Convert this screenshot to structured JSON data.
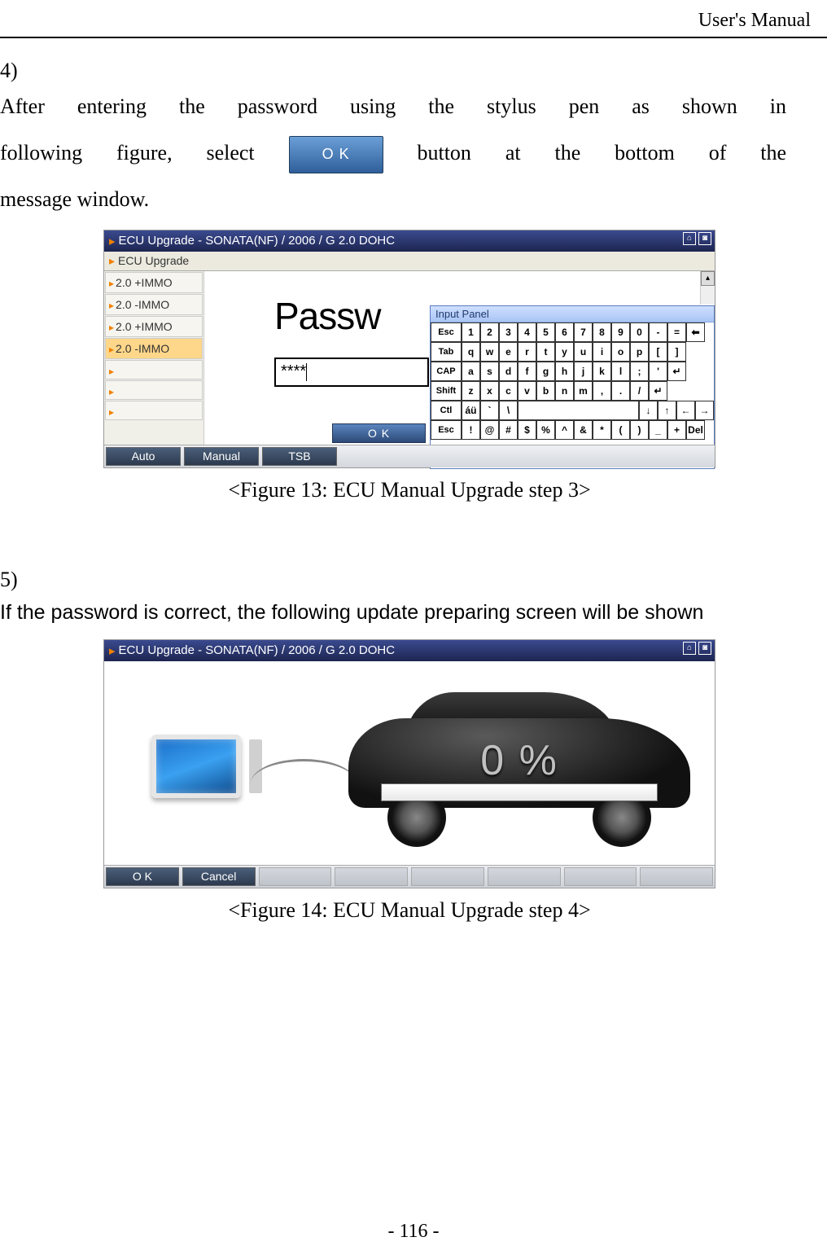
{
  "running_head": "User's Manual",
  "page_number": "- 116 -",
  "step4": {
    "num": "4)",
    "line1_a": "After entering the password using the stylus pen as shown in",
    "line2_a": "following  figure,  select",
    "ok_label": "O K",
    "line2_b": "button  at  the  bottom  of  the",
    "line3": "message window."
  },
  "fig1": {
    "title": "ECU Upgrade - SONATA(NF) / 2006 / G 2.0 DOHC",
    "subtitle": "ECU Upgrade",
    "sidebar": [
      "2.0 +IMMO",
      "2.0 -IMMO",
      "2.0 +IMMO",
      "2.0 -IMMO"
    ],
    "pw_label": "Passw",
    "pw_value": "****",
    "ip_title": "Input Panel",
    "rows": {
      "r1": [
        "Esc",
        "1",
        "2",
        "3",
        "4",
        "5",
        "6",
        "7",
        "8",
        "9",
        "0",
        "-",
        "=",
        "⬅"
      ],
      "r2": [
        "Tab",
        "q",
        "w",
        "e",
        "r",
        "t",
        "y",
        "u",
        "i",
        "o",
        "p",
        "[",
        "]"
      ],
      "r3": [
        "CAP",
        "a",
        "s",
        "d",
        "f",
        "g",
        "h",
        "j",
        "k",
        "l",
        ";",
        "'"
      ],
      "r4": [
        "Shift",
        "z",
        "x",
        "c",
        "v",
        "b",
        "n",
        "m",
        ",",
        ".",
        "/"
      ],
      "r5": [
        "Ctl",
        "áü",
        "`",
        "\\",
        " ",
        "↓",
        "↑",
        "←",
        "→"
      ],
      "r6": [
        "Esc",
        "!",
        "@",
        "#",
        "$",
        "%",
        "^",
        "&",
        "*",
        "(",
        ")",
        "_",
        "+",
        "Del"
      ]
    },
    "ok_mini": "O K",
    "tabs": [
      "Auto",
      "Manual",
      "TSB"
    ]
  },
  "caption1": "<Figure 13: ECU Manual Upgrade step 3>",
  "step5": {
    "num": "5)",
    "text": "If the password is correct, the following update preparing screen will be shown"
  },
  "fig2": {
    "title": "ECU Upgrade - SONATA(NF) / 2006 / G 2.0 DOHC",
    "percent": "0 %",
    "tabs": [
      "O K",
      "Cancel"
    ]
  },
  "caption2": "<Figure 14: ECU Manual Upgrade step 4>"
}
